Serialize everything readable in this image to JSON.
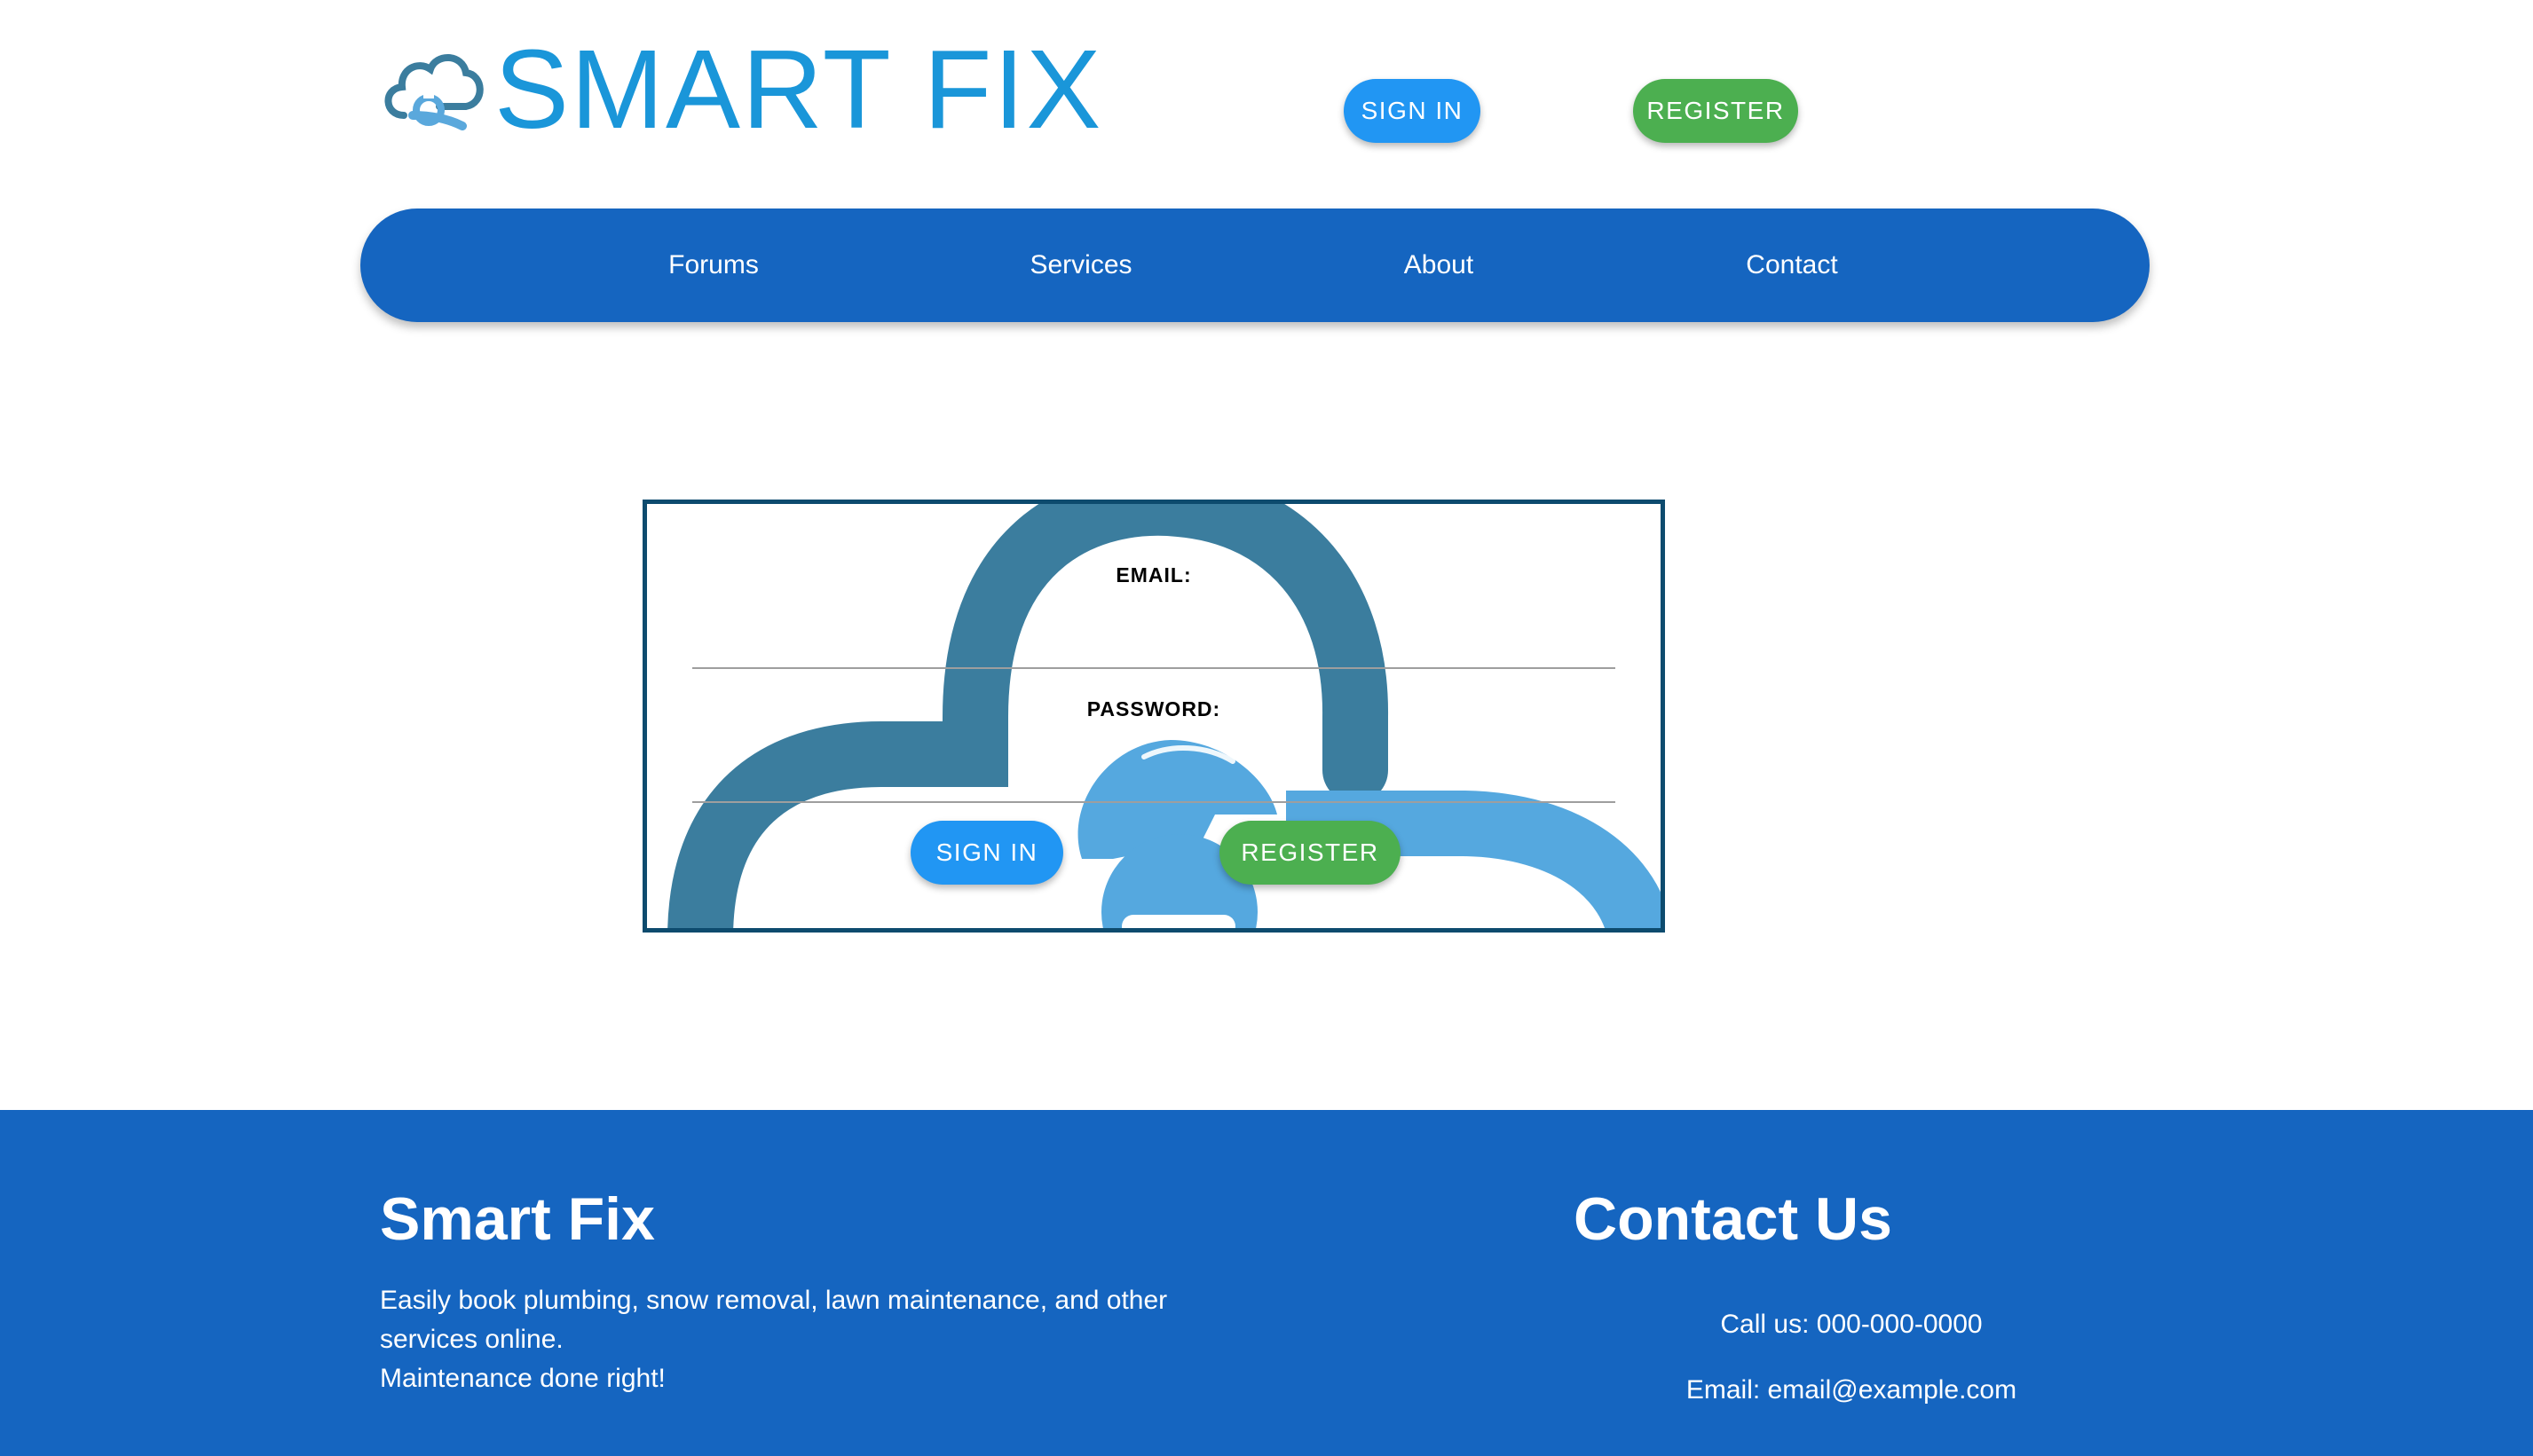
{
  "header": {
    "logo_text": "SMART FIX",
    "signin_label": "SIGN IN",
    "register_label": "REGISTER"
  },
  "nav": {
    "items": [
      {
        "label": "Forums"
      },
      {
        "label": "Services"
      },
      {
        "label": "About"
      },
      {
        "label": "Contact"
      }
    ]
  },
  "login": {
    "email_label": "EMAIL:",
    "email_value": "",
    "password_label": "PASSWORD:",
    "password_value": "",
    "signin_label": "SIGN IN",
    "register_label": "REGISTER"
  },
  "footer": {
    "brand_title": "Smart Fix",
    "description_line1": "Easily book plumbing, snow removal, lawn maintenance, and other services online.",
    "description_line2": "Maintenance done right!",
    "contact_title": "Contact Us",
    "phone": "Call us: 000-000-0000",
    "email": "Email: email@example.com"
  },
  "colors": {
    "brand_blue": "#1565c0",
    "logo_text": "#1a96d9",
    "signin_button": "#2196f3",
    "register_button": "#4caf50",
    "card_border": "#0d4b6e"
  },
  "icons": {
    "logo": "cloud-wrench-icon",
    "card_background": "cloud-wrench-illustration"
  }
}
